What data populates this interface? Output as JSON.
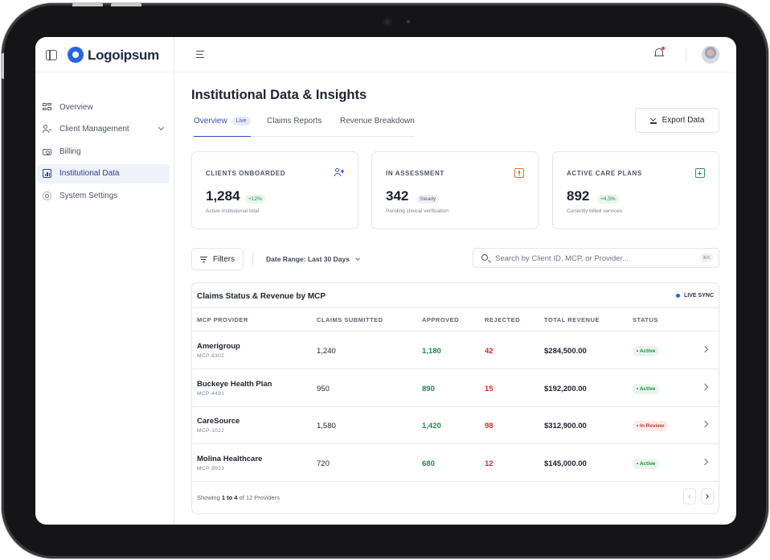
{
  "brand": {
    "name": "Logoipsum",
    "accent": "#2563eb"
  },
  "sidebar": {
    "items": [
      {
        "label": "Overview",
        "icon": "grid-icon"
      },
      {
        "label": "Client Management",
        "icon": "users-icon",
        "expandable": true
      },
      {
        "label": "Billing",
        "icon": "billing-icon"
      },
      {
        "label": "Institutional Data",
        "icon": "chart-icon",
        "active": true
      },
      {
        "label": "System Settings",
        "icon": "gear-icon"
      }
    ]
  },
  "topbar": {
    "menu_icon": "menu-collapse-icon",
    "notification_icon": "bell-icon",
    "avatar": "user-avatar"
  },
  "page": {
    "title": "Institutional Data & Insights",
    "tabs": [
      {
        "label": "Overview",
        "badge": "Live",
        "active": true
      },
      {
        "label": "Claims Reports"
      },
      {
        "label": "Revenue Breakdown"
      }
    ],
    "export_label": "Export Data"
  },
  "stats": [
    {
      "label": "CLIENTS ONBOARDED",
      "value": "1,284",
      "pill": "+12%",
      "pill_tone": "green",
      "sub": "Active institutional total",
      "icon": "user-plus-icon",
      "color": "#3b5bdb"
    },
    {
      "label": "IN ASSESSMENT",
      "value": "342",
      "pill": "Steady",
      "pill_tone": "gray",
      "sub": "Pending clinical verification",
      "icon": "clipboard-alert-icon",
      "color": "#ea6a1f"
    },
    {
      "label": "ACTIVE CARE PLANS",
      "value": "892",
      "pill": "+4.5%",
      "pill_tone": "green",
      "sub": "Currently billed services",
      "icon": "medical-bag-icon",
      "color": "#1f9d55"
    }
  ],
  "toolbar": {
    "filters_label": "Filters",
    "date_range": "Date Range: Last 30 Days",
    "search_placeholder": "Search by Client ID, MCP, or Provider...",
    "search_value": "",
    "shortcut": "⌘K"
  },
  "table": {
    "title": "Claims Status & Revenue by MCP",
    "live_label": "LIVE SYNC",
    "columns": [
      "MCP PROVIDER",
      "CLAIMS SUBMITTED",
      "APPROVED",
      "REJECTED",
      "TOTAL REVENUE",
      "STATUS"
    ],
    "rows": [
      {
        "name": "Amerigroup",
        "id": "MCP-8302",
        "submitted": "1,240",
        "approved": "1,180",
        "rejected": "42",
        "revenue": "$284,500.00",
        "status": "• Active",
        "tone": "active"
      },
      {
        "name": "Buckeye Health Plan",
        "id": "MCP-4491",
        "submitted": "950",
        "approved": "890",
        "rejected": "15",
        "revenue": "$192,200.00",
        "status": "• Active",
        "tone": "active"
      },
      {
        "name": "CareSource",
        "id": "MCP-1022",
        "submitted": "1,580",
        "approved": "1,420",
        "rejected": "98",
        "revenue": "$312,900.00",
        "status": "• In Review",
        "tone": "review"
      },
      {
        "name": "Molina Healthcare",
        "id": "MCP-9923",
        "submitted": "720",
        "approved": "680",
        "rejected": "12",
        "revenue": "$145,000.00",
        "status": "• Active",
        "tone": "active"
      }
    ],
    "footer": {
      "prefix": "Showing ",
      "range": "1 to 4",
      "suffix": " of 12 Providers"
    }
  }
}
